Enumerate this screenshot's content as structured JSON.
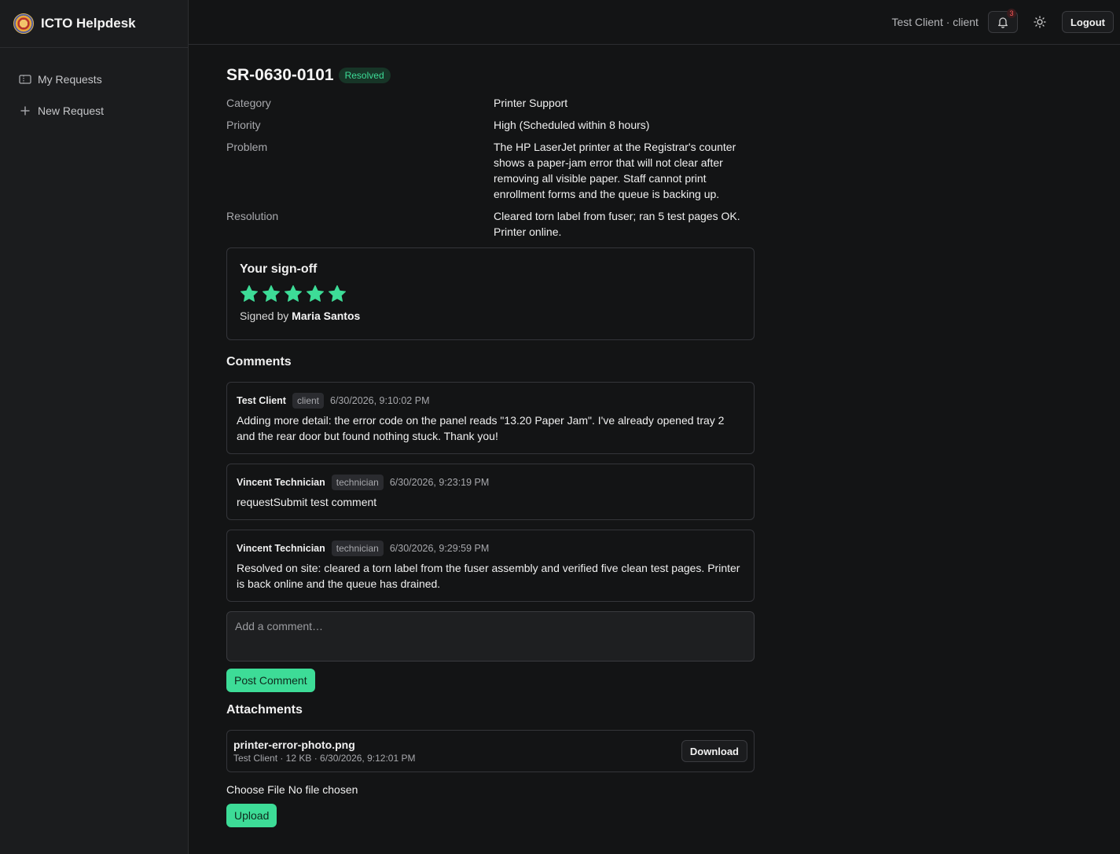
{
  "brand": {
    "title": "ICTO Helpdesk",
    "logo_icon": "seal-logo-icon"
  },
  "sidebar": {
    "items": [
      {
        "label": "My Requests",
        "icon": "ticket-icon"
      },
      {
        "label": "New Request",
        "icon": "plus-icon"
      }
    ]
  },
  "header": {
    "user_label": "Test Client · client",
    "notification_count": "3",
    "logout_label": "Logout"
  },
  "request": {
    "id": "SR-0630-0101",
    "status": "Resolved",
    "fields": [
      {
        "label": "Category",
        "value": "Printer Support"
      },
      {
        "label": "Priority",
        "value": "High (Scheduled within 8 hours)"
      },
      {
        "label": "Problem",
        "value": "The HP LaserJet printer at the Registrar's counter shows a paper-jam error that will not clear after removing all visible paper. Staff cannot print enrollment forms and the queue is backing up."
      },
      {
        "label": "Resolution",
        "value": "Cleared torn label from fuser; ran 5 test pages OK. Printer online."
      }
    ]
  },
  "signoff": {
    "title": "Your sign-off",
    "rating": 5,
    "rating_max": 5,
    "signed_prefix": "Signed by",
    "signed_name": "Maria Santos",
    "star_color": "#3ddc97"
  },
  "comments": {
    "title": "Comments",
    "items": [
      {
        "author": "Test Client",
        "role": "client",
        "time": "6/30/2026, 9:10:02 PM",
        "body": "Adding more detail: the error code on the panel reads \"13.20 Paper Jam\". I've already opened tray 2 and the rear door but found nothing stuck. Thank you!"
      },
      {
        "author": "Vincent Technician",
        "role": "technician",
        "time": "6/30/2026, 9:23:19 PM",
        "body": "requestSubmit test comment"
      },
      {
        "author": "Vincent Technician",
        "role": "technician",
        "time": "6/30/2026, 9:29:59 PM",
        "body": "Resolved on site: cleared a torn label from the fuser assembly and verified five clean test pages. Printer is back online and the queue has drained."
      }
    ],
    "input_placeholder": "Add a comment…",
    "post_label": "Post Comment"
  },
  "attachments": {
    "title": "Attachments",
    "items": [
      {
        "name": "printer-error-photo.png",
        "meta": "Test Client · 12 KB · 6/30/2026, 9:12:01 PM",
        "download_label": "Download"
      }
    ],
    "choose_file_label": "Choose File",
    "no_file_label": "No file chosen",
    "upload_label": "Upload"
  },
  "colors": {
    "accent": "#3ddc97",
    "background": "#131415",
    "sidebar": "#1b1c1e"
  }
}
